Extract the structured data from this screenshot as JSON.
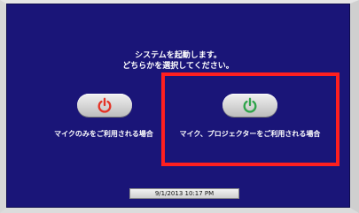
{
  "message": {
    "line1": "システムを起動します。",
    "line2": "どちらかを選択してください。"
  },
  "options": [
    {
      "label": "マイクのみをご利用される場合",
      "icon": "power-icon",
      "icon_color": "#e53326"
    },
    {
      "label": "マイク、プロジェクターをご利用される場合",
      "icon": "power-icon",
      "icon_color": "#2fa44a"
    }
  ],
  "datetime": "9/1/2013 10:17 PM",
  "colors": {
    "background": "#1a1578",
    "highlight": "#ff1f1f"
  }
}
